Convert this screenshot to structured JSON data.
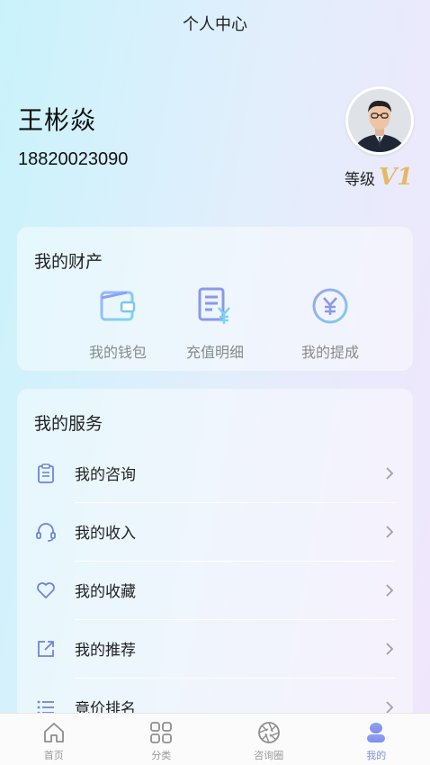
{
  "header": {
    "title": "个人中心"
  },
  "profile": {
    "name": "王彬焱",
    "phone": "18820023090",
    "level_label": "等级",
    "level_badge": "V1"
  },
  "assets": {
    "title": "我的财产",
    "items": [
      {
        "label": "我的钱包",
        "icon": "wallet-icon"
      },
      {
        "label": "充值明细",
        "icon": "recharge-record-icon"
      },
      {
        "label": "我的提成",
        "icon": "yen-coin-icon"
      }
    ]
  },
  "services": {
    "title": "我的服务",
    "items": [
      {
        "label": "我的咨询",
        "icon": "clipboard-icon"
      },
      {
        "label": "我的收入",
        "icon": "headset-icon"
      },
      {
        "label": "我的收藏",
        "icon": "heart-icon"
      },
      {
        "label": "我的推荐",
        "icon": "share-icon"
      },
      {
        "label": "竟价排名",
        "icon": "list-icon"
      }
    ]
  },
  "tabbar": {
    "items": [
      {
        "label": "首页",
        "icon": "home-icon"
      },
      {
        "label": "分类",
        "icon": "category-grid-icon"
      },
      {
        "label": "咨询圈",
        "icon": "aperture-icon"
      },
      {
        "label": "我的",
        "icon": "profile-icon"
      }
    ],
    "active_index": 3
  },
  "colors": {
    "accent": "#8190e8",
    "icon_blue": "#6f83dd",
    "gold": "#e4b964"
  }
}
